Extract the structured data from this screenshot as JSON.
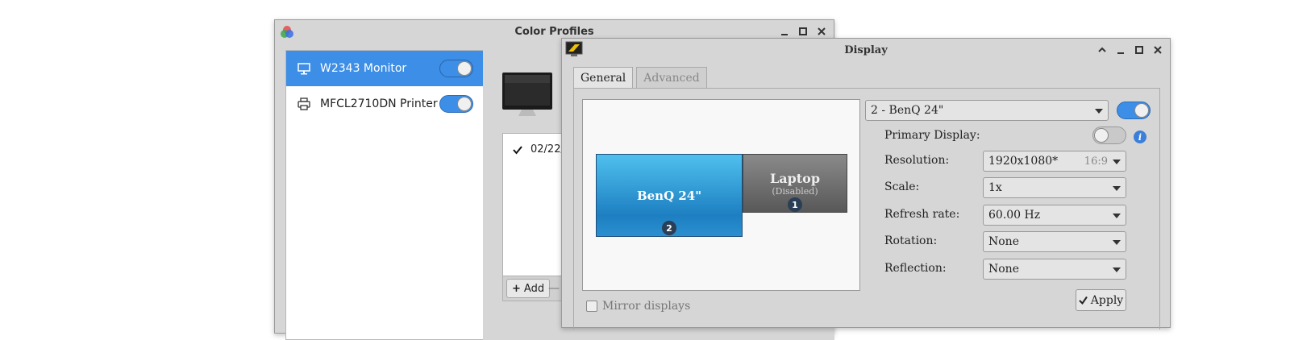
{
  "color_profiles": {
    "title": "Color Profiles",
    "devices": [
      {
        "label": "W2343 Monitor",
        "icon": "monitor-icon",
        "enabled": true,
        "selected": true
      },
      {
        "label": "MFCL2710DN Printer",
        "icon": "printer-icon",
        "enabled": true,
        "selected": false
      }
    ],
    "profile_rows": [
      {
        "label": "02/22/",
        "checked": true
      }
    ],
    "add_label": "Add",
    "remove_label": "—"
  },
  "display": {
    "title": "Display",
    "tabs": [
      {
        "label": "General",
        "active": true
      },
      {
        "label": "Advanced",
        "active": false
      }
    ],
    "preview": {
      "benq": {
        "name": "BenQ 24\"",
        "number": "2"
      },
      "laptop": {
        "name": "Laptop",
        "status": "(Disabled)",
        "number": "1"
      }
    },
    "monitor_select": "2 - BenQ 24\"",
    "monitor_enabled": true,
    "primary_label": "Primary Display:",
    "primary_enabled": false,
    "resolution": {
      "label": "Resolution:",
      "value": "1920x1080*",
      "ratio": "16:9"
    },
    "scale": {
      "label": "Scale:",
      "value": "1x"
    },
    "refresh": {
      "label": "Refresh rate:",
      "value": "60.00 Hz"
    },
    "rotation": {
      "label": "Rotation:",
      "value": "None"
    },
    "reflection": {
      "label": "Reflection:",
      "value": "None"
    },
    "mirror_label": "Mirror displays",
    "apply_label": "Apply",
    "info_glyph": "i"
  },
  "colors": {
    "accent": "#3d8ee6",
    "window_bg": "#d6d6d6"
  }
}
